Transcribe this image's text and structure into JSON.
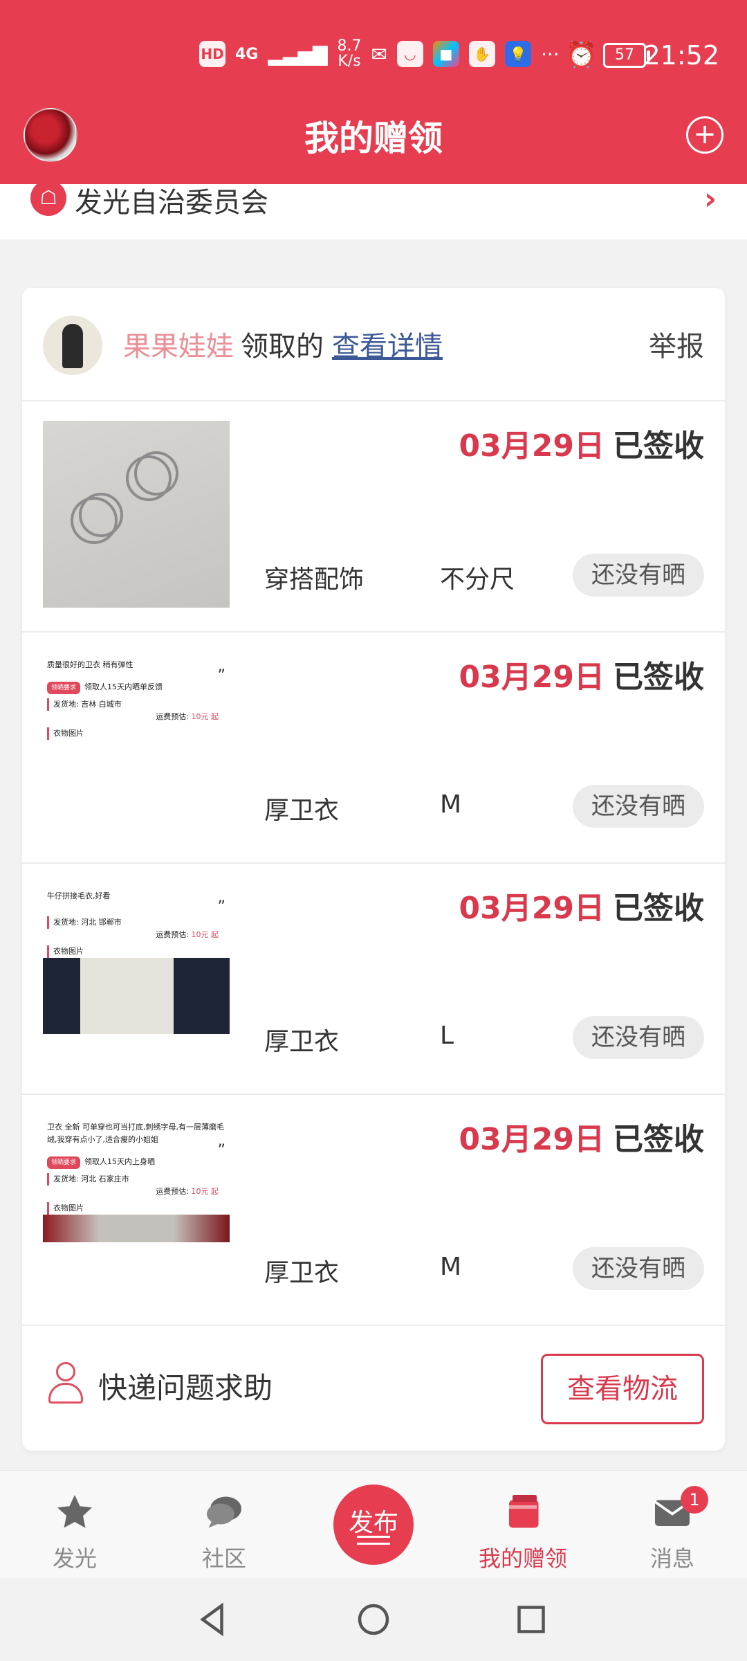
{
  "status": {
    "time": "21:52",
    "net_speed_value": "8.7",
    "net_speed_unit": "K/s",
    "signal": "4G",
    "battery": "57"
  },
  "header": {
    "title": "我的赠领"
  },
  "group": {
    "name": "发光自治委员会"
  },
  "card": {
    "user_name": "果果娃娃",
    "action_text": "领取的",
    "detail_link": "查看详情",
    "report": "举报",
    "items": [
      {
        "date": "03月29日",
        "status": "已签收",
        "category": "穿搭配饰",
        "size": "不分尺",
        "show": "还没有晒"
      },
      {
        "date": "03月29日",
        "status": "已签收",
        "category": "厚卫衣",
        "size": "M",
        "show": "还没有晒",
        "thumb": {
          "desc": "质量很好的卫衣 稍有弹性",
          "tag": "领晒要求",
          "req": "领取人15天内晒单反馈",
          "origin_label": "发货地:",
          "origin": "吉林 白城市",
          "fee_label": "运费预估:",
          "fee": "10元 起",
          "pics": "衣物图片"
        }
      },
      {
        "date": "03月29日",
        "status": "已签收",
        "category": "厚卫衣",
        "size": "L",
        "show": "还没有晒",
        "thumb": {
          "desc": "牛仔拼接毛衣,好看",
          "origin_label": "发货地:",
          "origin": "河北 邯郸市",
          "fee_label": "运费预估:",
          "fee": "10元 起",
          "pics": "衣物图片"
        }
      },
      {
        "date": "03月29日",
        "status": "已签收",
        "category": "厚卫衣",
        "size": "M",
        "show": "还没有晒",
        "thumb": {
          "desc": "卫衣 全新 可单穿也可当打底,刺绣字母,有一层薄磨毛绒,我穿有点小了,适合瘦的小姐姐",
          "tag": "领晒要求",
          "req": "领取人15天内上身晒",
          "origin_label": "发货地:",
          "origin": "河北 石家庄市",
          "fee_label": "运费预估:",
          "fee": "10元 起",
          "pics": "衣物图片"
        }
      }
    ],
    "help": "快递问题求助",
    "logistics": "查看物流"
  },
  "nav": {
    "tabs": [
      {
        "label": "发光",
        "icon": "star-icon"
      },
      {
        "label": "社区",
        "icon": "chat-bubble-icon"
      },
      {
        "label": "发布",
        "icon": "publish-icon"
      },
      {
        "label": "我的赠领",
        "icon": "gift-box-icon"
      },
      {
        "label": "消息",
        "icon": "mail-icon"
      }
    ],
    "message_badge": "1",
    "active_color": "#d8394c"
  },
  "colors": {
    "brand": "#e63e50",
    "date_red": "#d8394c",
    "username_pink": "#eb8f97",
    "link_blue": "#3c5896"
  }
}
